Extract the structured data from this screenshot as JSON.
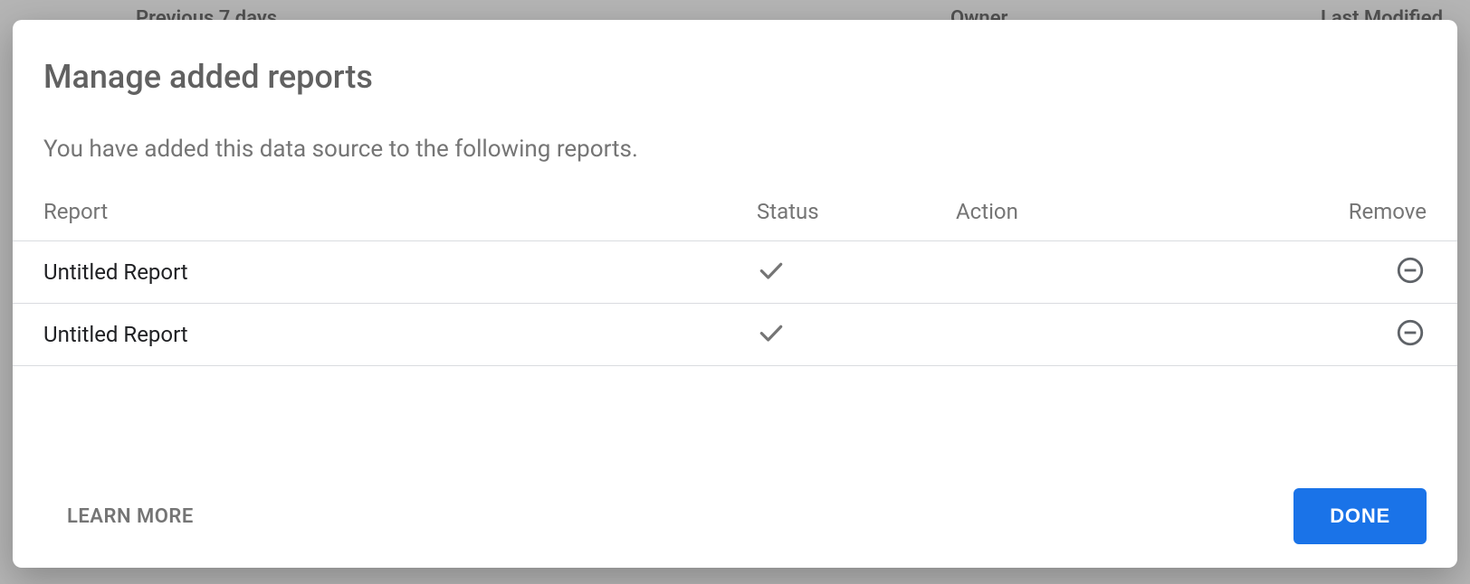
{
  "background": {
    "section_label": "Previous 7 days",
    "col_owner": "Owner",
    "col_last_modified": "Last Modified"
  },
  "dialog": {
    "title": "Manage added reports",
    "description": "You have added this data source to the following reports.",
    "columns": {
      "report": "Report",
      "status": "Status",
      "action": "Action",
      "remove": "Remove"
    },
    "rows": [
      {
        "report": "Untitled Report",
        "status": "ok",
        "action": "",
        "removable": true
      },
      {
        "report": "Untitled Report",
        "status": "ok",
        "action": "",
        "removable": true
      }
    ],
    "footer": {
      "learn_more": "Learn more",
      "done": "Done"
    }
  },
  "colors": {
    "primary": "#1a73e8",
    "text_muted": "#757575",
    "divider": "#dadce0"
  }
}
